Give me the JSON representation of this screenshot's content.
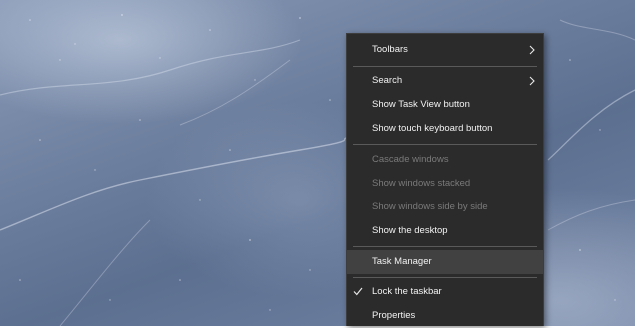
{
  "context_menu": {
    "items": [
      {
        "label": "Toolbars",
        "enabled": true,
        "submenu": true
      },
      {
        "label": "Search",
        "enabled": true,
        "submenu": true
      },
      {
        "label": "Show Task View button",
        "enabled": true
      },
      {
        "label": "Show touch keyboard button",
        "enabled": true
      },
      {
        "label": "Cascade windows",
        "enabled": false
      },
      {
        "label": "Show windows stacked",
        "enabled": false
      },
      {
        "label": "Show windows side by side",
        "enabled": false
      },
      {
        "label": "Show the desktop",
        "enabled": true
      },
      {
        "label": "Task Manager",
        "enabled": true,
        "highlighted": true
      },
      {
        "label": "Lock the taskbar",
        "enabled": true,
        "checked": true
      },
      {
        "label": "Properties",
        "enabled": true
      }
    ]
  },
  "icons": {
    "submenu_arrow": "chevron-right-icon",
    "checked_mark": "checkmark-icon"
  },
  "colors": {
    "menu_background": "#2b2b2b",
    "menu_text": "#f2f2f2",
    "menu_text_disabled": "#7a7a7a",
    "menu_hover": "#414141",
    "separator": "#5a5a5a"
  }
}
